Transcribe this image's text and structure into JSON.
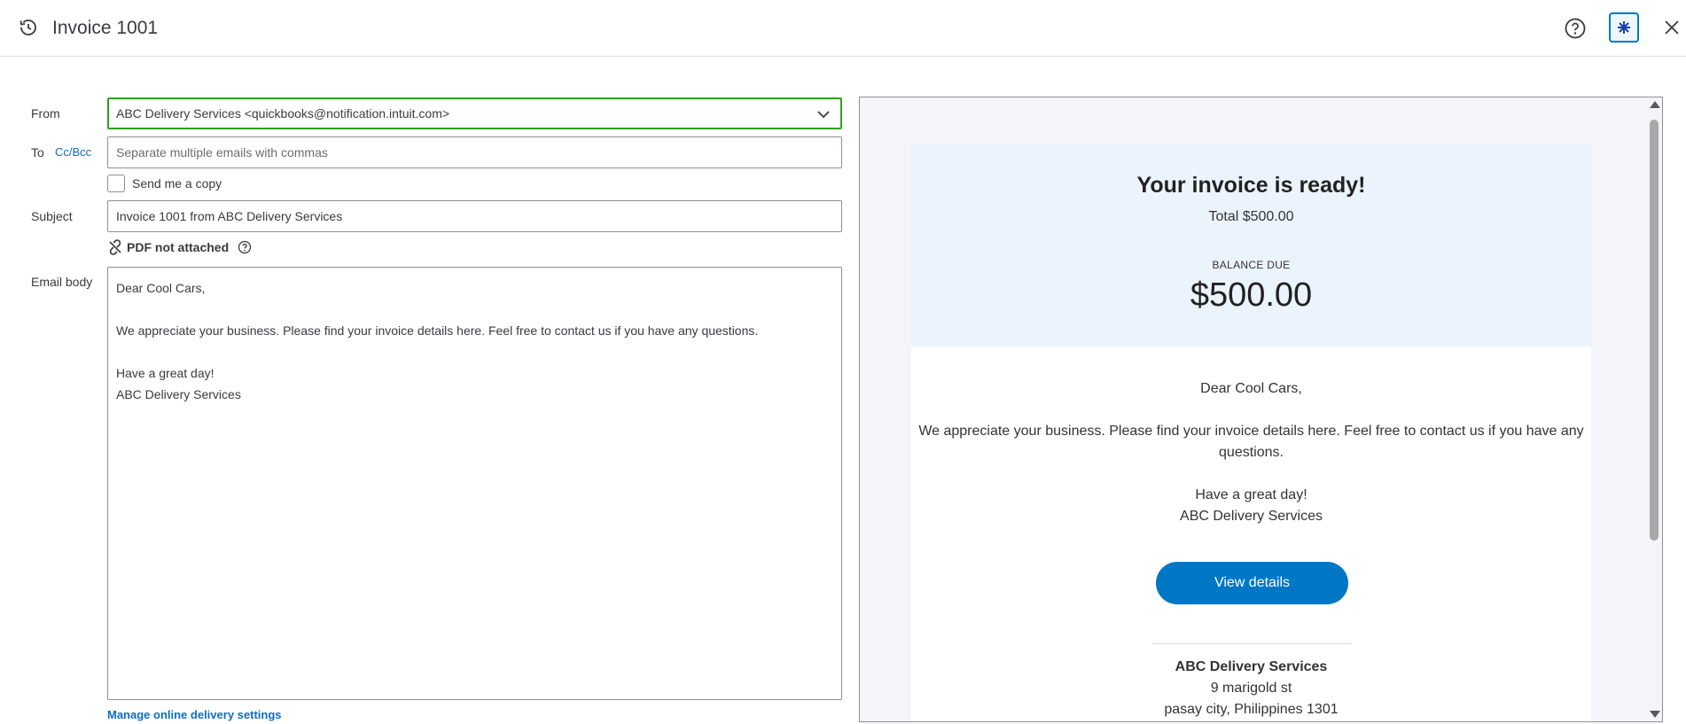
{
  "header": {
    "title": "Invoice 1001"
  },
  "form": {
    "from_label": "From",
    "from_value": "ABC Delivery Services <quickbooks@notification.intuit.com>",
    "to_label": "To",
    "ccbcc_label": "Cc/Bcc",
    "to_placeholder": "Separate multiple emails with commas",
    "send_copy_label": "Send me a copy",
    "send_copy_checked": false,
    "subject_label": "Subject",
    "subject_value": "Invoice 1001 from ABC Delivery Services",
    "pdf_status": "PDF not attached",
    "body_label": "Email body",
    "body_lines": [
      "Dear Cool Cars,",
      "We appreciate your business. Please find your invoice details here. Feel free to contact us if you have any questions.",
      "Have a great day!",
      "ABC Delivery Services"
    ],
    "manage_link": "Manage online delivery settings"
  },
  "preview": {
    "heading": "Your invoice is ready!",
    "total": "Total $500.00",
    "balance_label": "BALANCE DUE",
    "balance_amount": "$500.00",
    "greeting": "Dear Cool Cars,",
    "message": "We appreciate your business. Please find your invoice details here. Feel free to contact us if you have any questions.",
    "signoff_1": "Have a great day!",
    "signoff_2": "ABC Delivery Services",
    "button_label": "View details",
    "company_name": "ABC Delivery Services",
    "address_1": "9 marigold st",
    "address_2": "pasay city, Philippines 1301"
  },
  "colors": {
    "accent": "#0077c5",
    "link": "#0d6ec1",
    "focus_green": "#2ca01c",
    "preview_banner": "#ebf4fc"
  },
  "icons": {
    "history": "history-icon",
    "help": "help-icon",
    "assistant": "ai-assist-icon",
    "close": "close-icon",
    "chevron": "chevron-down-icon",
    "unlink": "unlink-icon",
    "info": "question-circle-icon"
  }
}
